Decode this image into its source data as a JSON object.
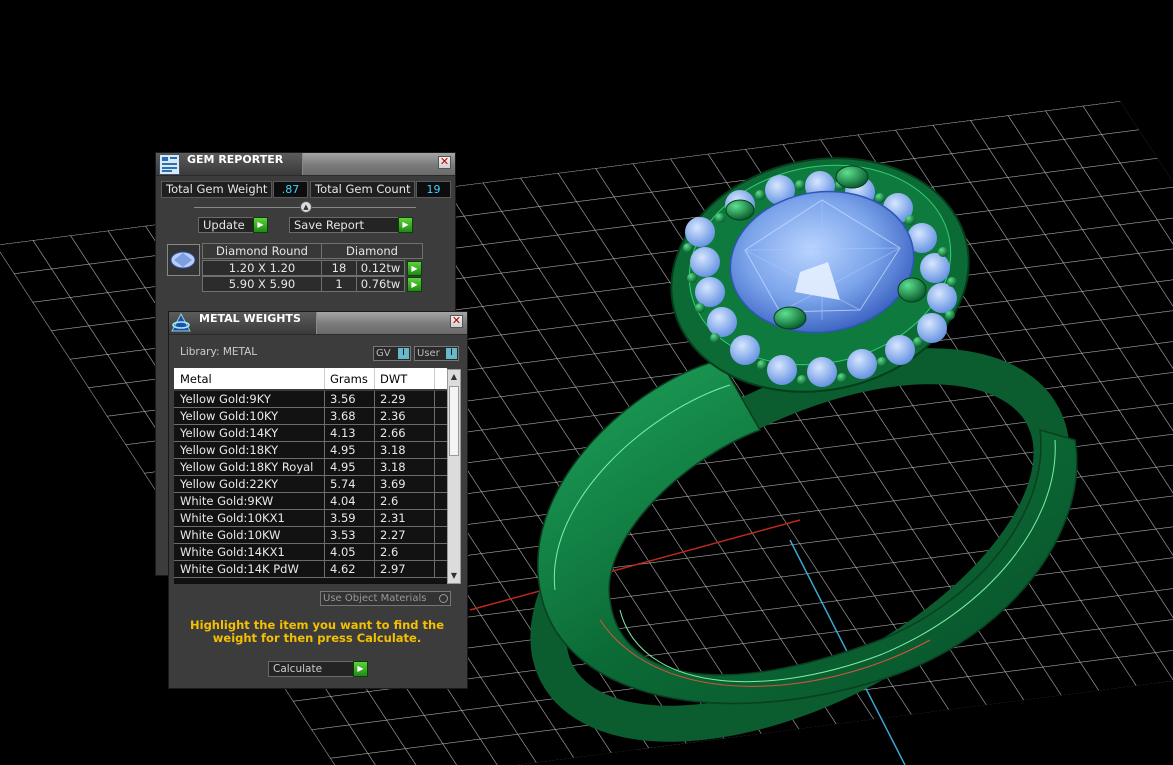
{
  "gem_reporter": {
    "title": "GEM REPORTER",
    "total_weight_label": "Total Gem Weight",
    "total_weight_value": ".87",
    "total_count_label": "Total Gem Count",
    "total_count_value": "19",
    "update_label": "Update",
    "save_report_label": "Save Report",
    "table": {
      "header_shape": "Diamond Round",
      "header_material": "Diamond",
      "rows": [
        {
          "size": "1.20 X 1.20",
          "count": "18",
          "weight": "0.12tw"
        },
        {
          "size": "5.90 X 5.90",
          "count": "1",
          "weight": "0.76tw"
        }
      ]
    }
  },
  "metal_weights": {
    "title": "METAL WEIGHTS",
    "library_label": "Library: METAL",
    "gv_toggle": "GV",
    "user_toggle": "User",
    "columns": [
      "Metal",
      "Grams",
      "DWT"
    ],
    "rows": [
      {
        "metal": "Yellow Gold:9KY",
        "grams": "3.56",
        "dwt": "2.29"
      },
      {
        "metal": "Yellow Gold:10KY",
        "grams": "3.68",
        "dwt": "2.36"
      },
      {
        "metal": "Yellow Gold:14KY",
        "grams": "4.13",
        "dwt": "2.66"
      },
      {
        "metal": "Yellow Gold:18KY",
        "grams": "4.95",
        "dwt": "3.18"
      },
      {
        "metal": "Yellow Gold:18KY Royal",
        "grams": "4.95",
        "dwt": "3.18"
      },
      {
        "metal": "Yellow Gold:22KY",
        "grams": "5.74",
        "dwt": "3.69"
      },
      {
        "metal": "White Gold:9KW",
        "grams": "4.04",
        "dwt": "2.6"
      },
      {
        "metal": "White Gold:10KX1",
        "grams": "3.59",
        "dwt": "2.31"
      },
      {
        "metal": "White Gold:10KW",
        "grams": "3.53",
        "dwt": "2.27"
      },
      {
        "metal": "White Gold:14KX1",
        "grams": "4.05",
        "dwt": "2.6"
      },
      {
        "metal": "White Gold:14K PdW",
        "grams": "4.62",
        "dwt": "2.97"
      }
    ],
    "use_object_materials_label": "Use Object Materials",
    "hint_text": "Highlight the item you want to find the weight for then press Calculate.",
    "calculate_label": "Calculate"
  },
  "colors": {
    "ring_metal": "#0e7a3e",
    "gem": "#7aa8f0",
    "value_text": "#3fd4ff",
    "hint_text": "#f5c000",
    "go_button": "#2aa81c"
  },
  "icons": {
    "gem_reporter": "gem-report-icon",
    "metal_weights": "scale-icon",
    "row_go": "green-arrow-icon"
  }
}
